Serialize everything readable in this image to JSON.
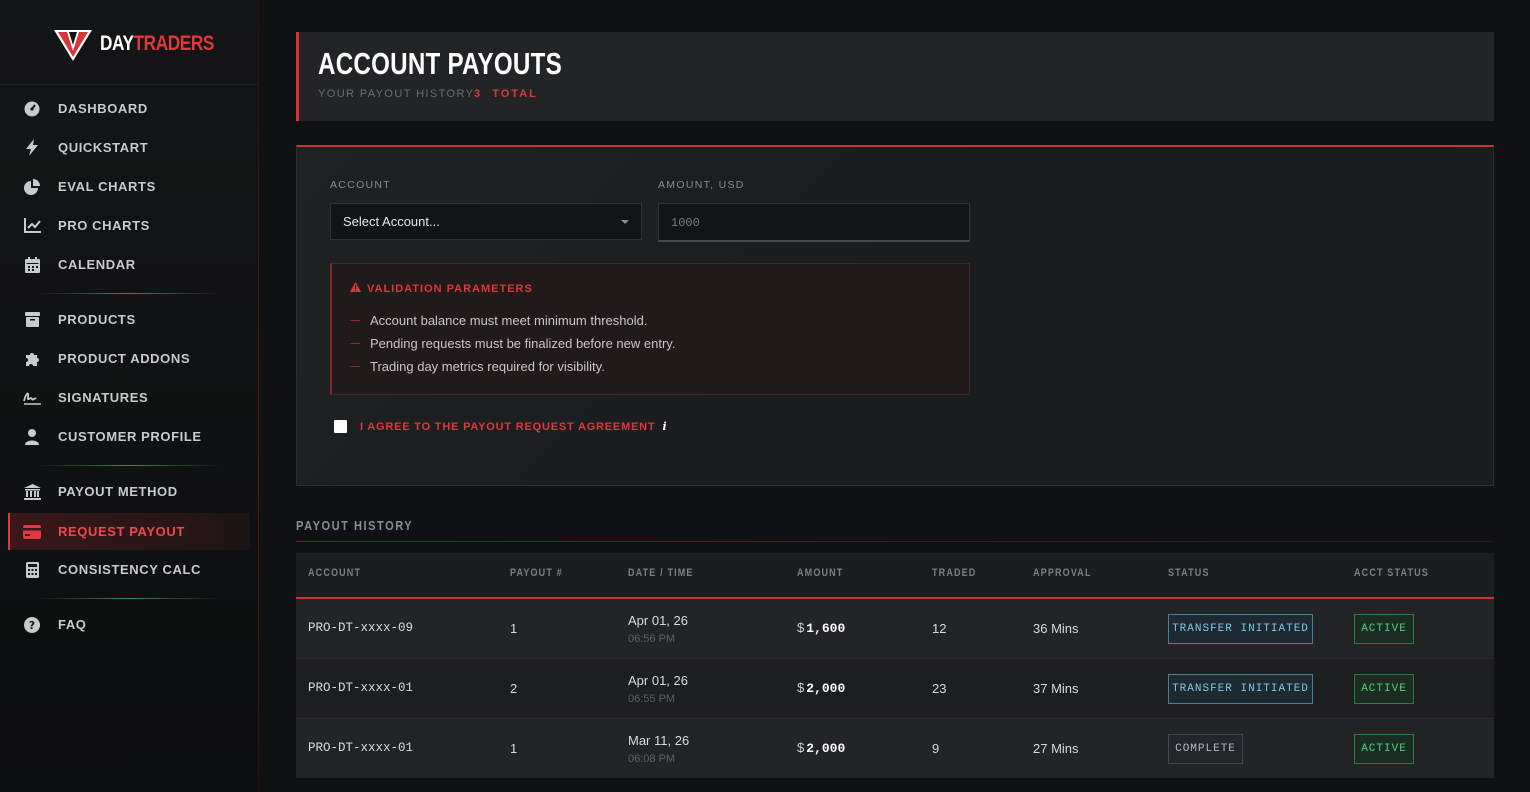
{
  "brand": {
    "day": "DAY",
    "traders": "TRADERS"
  },
  "sidebar": {
    "items": [
      {
        "label": "DASHBOARD",
        "icon": "dashboard-gauge-icon"
      },
      {
        "label": "QUICKSTART",
        "icon": "lightning-bolt-icon"
      },
      {
        "label": "EVAL CHARTS",
        "icon": "pie-chart-icon"
      },
      {
        "label": "PRO CHARTS",
        "icon": "line-chart-icon"
      },
      {
        "label": "CALENDAR",
        "icon": "calendar-icon"
      },
      {
        "label": "PRODUCTS",
        "icon": "box-icon"
      },
      {
        "label": "PRODUCT ADDONS",
        "icon": "puzzle-icon"
      },
      {
        "label": "SIGNATURES",
        "icon": "signature-icon"
      },
      {
        "label": "CUSTOMER PROFILE",
        "icon": "user-icon"
      },
      {
        "label": "PAYOUT METHOD",
        "icon": "bank-icon"
      },
      {
        "label": "REQUEST PAYOUT",
        "icon": "credit-card-icon",
        "active": true
      },
      {
        "label": "CONSISTENCY CALC",
        "icon": "calculator-icon"
      },
      {
        "label": "FAQ",
        "icon": "question-circle-icon"
      }
    ]
  },
  "header": {
    "title": "ACCOUNT PAYOUTS",
    "subtitle": "YOUR PAYOUT HISTORY",
    "total": "3  TOTAL"
  },
  "form": {
    "account_label": "ACCOUNT",
    "account_value": "Select Account...",
    "amount_label": "AMOUNT, USD",
    "amount_placeholder": "1000",
    "validation": {
      "title": "VALIDATION PARAMETERS",
      "rules": [
        "Account balance must meet minimum threshold.",
        "Pending requests must be finalized before new entry.",
        "Trading day metrics required for visibility."
      ]
    },
    "agree_label": "I AGREE TO THE PAYOUT REQUEST AGREEMENT",
    "info_glyph": "i"
  },
  "history": {
    "title": "PAYOUT HISTORY",
    "columns": [
      "ACCOUNT",
      "PAYOUT #",
      "DATE / TIME",
      "AMOUNT",
      "TRADED",
      "APPROVAL",
      "STATUS",
      "ACCT STATUS"
    ],
    "rows": [
      {
        "account": "PRO-DT-xxxx-09",
        "payout": "1",
        "date": "Apr 01, 26",
        "time": "06:56 PM",
        "currency": "$",
        "amount": "1,600",
        "traded": "12",
        "approval": "36 Mins",
        "status": "TRANSFER INITIATED",
        "acct_status": "ACTIVE"
      },
      {
        "account": "PRO-DT-xxxx-01",
        "payout": "2",
        "date": "Apr 01, 26",
        "time": "06:55 PM",
        "currency": "$",
        "amount": "2,000",
        "traded": "23",
        "approval": "37 Mins",
        "status": "TRANSFER INITIATED",
        "acct_status": "ACTIVE"
      },
      {
        "account": "PRO-DT-xxxx-01",
        "payout": "1",
        "date": "Mar 11, 26",
        "time": "06:08 PM",
        "currency": "$",
        "amount": "2,000",
        "traded": "9",
        "approval": "27 Mins",
        "status": "COMPLETE",
        "acct_status": "ACTIVE"
      }
    ]
  },
  "colors": {
    "accent": "#e0383b",
    "active_green": "#4fd07a",
    "transfer_blue": "#7fc6e6"
  }
}
